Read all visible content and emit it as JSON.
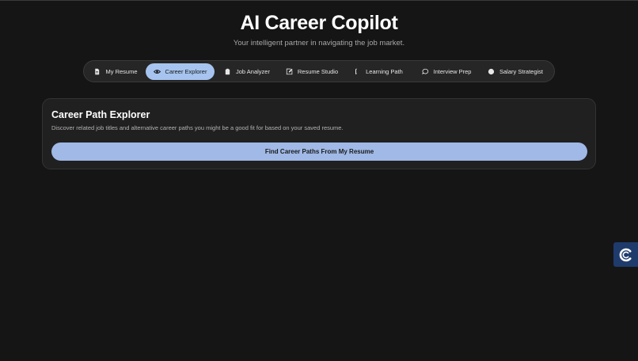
{
  "app": {
    "title": "AI Career Copilot",
    "subtitle": "Your intelligent partner in navigating the job market."
  },
  "tabs": [
    {
      "label": "My Resume",
      "icon": "document-icon",
      "active": false
    },
    {
      "label": "Career Explorer",
      "icon": "eye-icon",
      "active": true
    },
    {
      "label": "Job Analyzer",
      "icon": "clipboard-icon",
      "active": false
    },
    {
      "label": "Resume Studio",
      "icon": "edit-icon",
      "active": false
    },
    {
      "label": "Learning Path",
      "icon": "book-icon",
      "active": false
    },
    {
      "label": "Interview Prep",
      "icon": "chat-bubble-icon",
      "active": false
    },
    {
      "label": "Salary Strategist",
      "icon": "circle-icon",
      "active": false
    }
  ],
  "explorer": {
    "title": "Career Path Explorer",
    "description": "Discover related job titles and alternative career paths you might be a good fit for based on your saved resume.",
    "button_label": "Find Career Paths From My Resume"
  },
  "widget": {
    "icon": "c-logo-icon"
  },
  "colors": {
    "background": "#151515",
    "accent_active_tab": "#a6c4ef",
    "accent_button": "#a0b9e6",
    "widget": "#1f3b6c"
  }
}
